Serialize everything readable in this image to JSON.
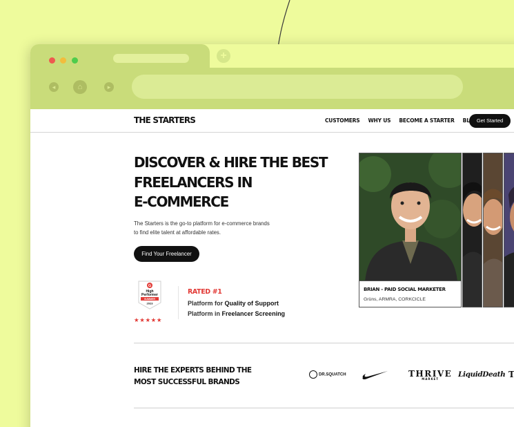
{
  "browser": {
    "new_tab_symbol": "+",
    "back_symbol": "◂",
    "home_symbol": "⌂",
    "forward_symbol": "▸"
  },
  "header": {
    "logo": "THE STARTERS",
    "menu": [
      "CUSTOMERS",
      "WHY US",
      "BECOME A STARTER",
      "BLOG"
    ],
    "cta": "Get Started"
  },
  "hero": {
    "title_lines": [
      "DISCOVER & HIRE THE BEST",
      "FREELANCERS IN",
      "E-COMMERCE"
    ],
    "description": "The Starters is the go-to platform for e-commerce brands to find elite talent at affordable rates.",
    "cta": "Find Your Freelancer"
  },
  "badge": {
    "brand": "G",
    "title_1": "High",
    "title_2": "Performer",
    "ribbon": "SUMMER",
    "year": "2023",
    "stars": "★★★★★"
  },
  "rating": {
    "headline": "RATED #1",
    "line1_prefix": "Platform for ",
    "line1_bold": "Quality of Support",
    "line2_prefix": "Platform in ",
    "line2_bold": "Freelancer Screening"
  },
  "featured": {
    "name": "BRIAN - PAID SOCIAL MARKETER",
    "brands": "Grüns, ARMRA, CORKCICLE"
  },
  "brands": {
    "title": "HIRE THE EXPERTS BEHIND THE MOST SUCCESSFUL BRANDS",
    "logos": [
      "DR.SQUATCH",
      "THRIVE",
      "MARKET",
      "LiquidDeath",
      "TR"
    ]
  },
  "colors": {
    "background": "#eefb9c",
    "browser_chrome": "#c9dc7a",
    "accent_red": "#e23a36",
    "dark": "#111111"
  }
}
